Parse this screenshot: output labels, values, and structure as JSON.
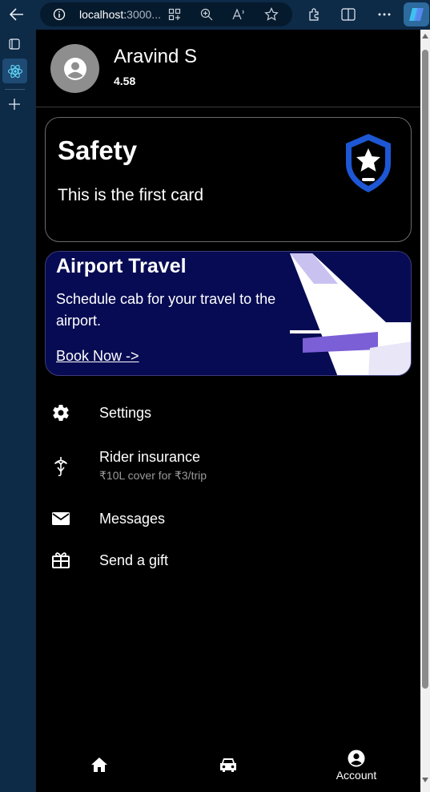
{
  "browser": {
    "url_host": "localhost:",
    "url_rest": "3000..."
  },
  "profile": {
    "name": "Aravind S",
    "rating": "4.58"
  },
  "safety_card": {
    "title": "Safety",
    "text": "This is the first card",
    "icon": "police-shield-icon",
    "accent_color": "#2a6df0"
  },
  "promo_card": {
    "title": "Airport Travel",
    "text": "Schedule cab for your travel to the airport.",
    "link": "Book Now ->",
    "background_color": "#070b53"
  },
  "menu": [
    {
      "label": "Settings",
      "sub": "",
      "icon": "gear-icon"
    },
    {
      "label": "Rider insurance",
      "sub": "₹10L cover for ₹3/trip",
      "icon": "umbrella-icon"
    },
    {
      "label": "Messages",
      "sub": "",
      "icon": "mail-icon"
    },
    {
      "label": "Send a gift",
      "sub": "",
      "icon": "gift-icon"
    }
  ],
  "bottom_nav": {
    "home_icon": "home-icon",
    "rides_icon": "car-icon",
    "account_label": "Account",
    "account_icon": "account-circle-icon",
    "active": "Account"
  }
}
